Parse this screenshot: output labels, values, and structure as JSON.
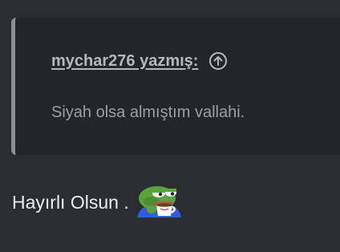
{
  "quote": {
    "author": "mychar276 yazmış:",
    "text": "Siyah olsa almıştım vallahi.",
    "jump_icon": "arrow-up-circle-icon"
  },
  "reply": {
    "text": "Hayırlı Olsun ."
  },
  "emoji": {
    "icon": "pepe-coffee-emoji-icon"
  },
  "colors": {
    "page_background": "#2b2d33",
    "quote_background": "#23252b",
    "quote_border": "#8a8e97",
    "author_text": "#b4b7be",
    "quote_text": "#9a9ea6",
    "reply_text": "#eceef2"
  }
}
